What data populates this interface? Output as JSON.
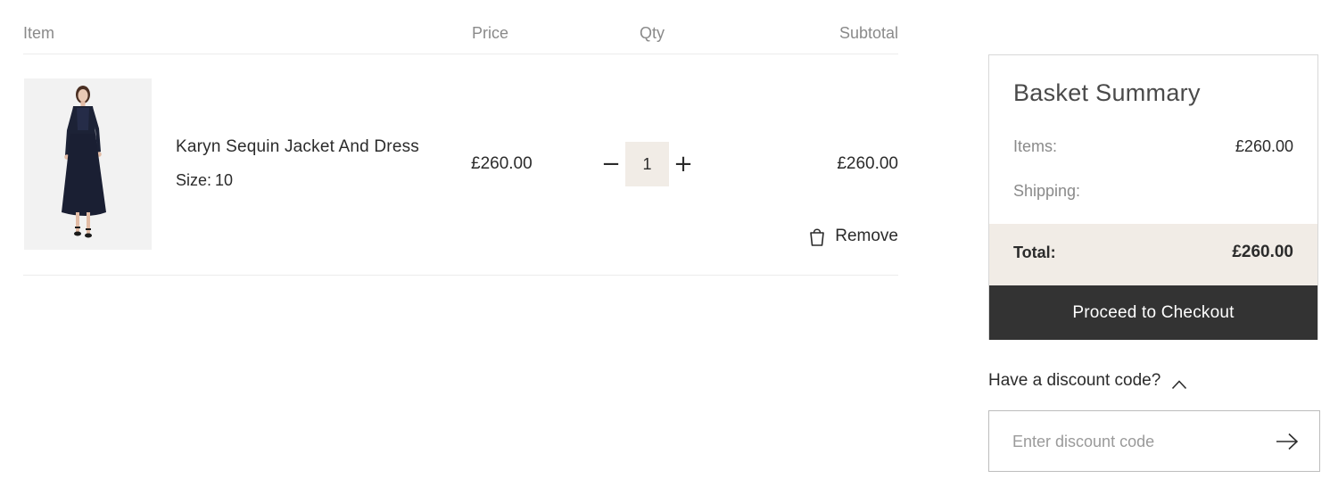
{
  "basket": {
    "headers": {
      "item": "Item",
      "price": "Price",
      "qty": "Qty",
      "subtotal": "Subtotal"
    },
    "items": [
      {
        "name": "Karyn Sequin Jacket And Dress",
        "size_label": "Size:",
        "size_value": "10",
        "price": "£260.00",
        "qty": "1",
        "qty_minus": "−",
        "qty_plus": "+",
        "subtotal": "£260.00",
        "remove_label": "Remove",
        "image_icon": "product-photo-dress"
      }
    ]
  },
  "summary": {
    "title": "Basket Summary",
    "items_label": "Items:",
    "items_value": "£260.00",
    "shipping_label": "Shipping:",
    "shipping_value": "",
    "total_label": "Total:",
    "total_value": "£260.00",
    "checkout_label": "Proceed to Checkout"
  },
  "discount": {
    "toggle_label": "Have a discount code?",
    "placeholder": "Enter discount code",
    "value": ""
  },
  "colors": {
    "accent_dark": "#333333",
    "panel_beige": "#f1ece6",
    "muted_text": "#8a8a8a"
  }
}
